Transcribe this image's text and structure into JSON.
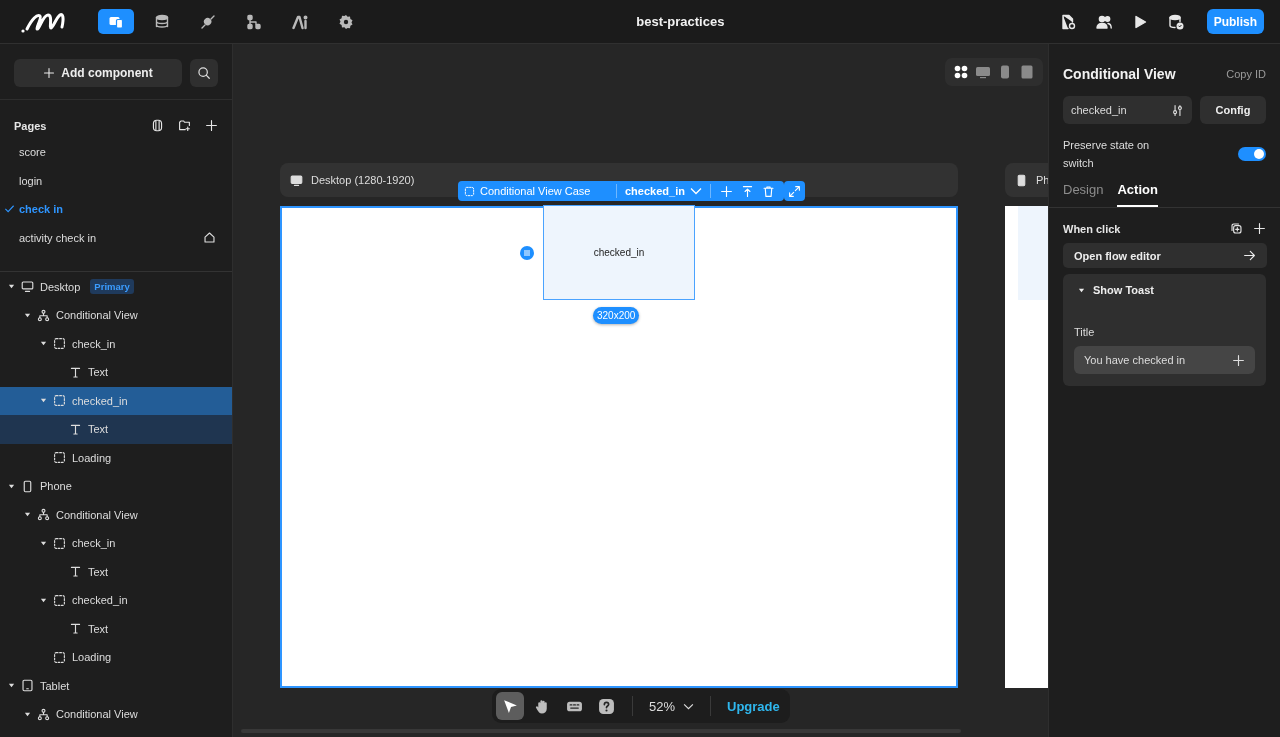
{
  "topbar": {
    "nav": [
      {
        "kind": "pages",
        "selected": true
      },
      {
        "kind": "database",
        "selected": false
      },
      {
        "kind": "plugin",
        "selected": false
      },
      {
        "kind": "flow",
        "selected": false
      },
      {
        "kind": "ai",
        "selected": false
      },
      {
        "kind": "settings",
        "selected": false
      }
    ],
    "title": "best-practices",
    "actions": [
      {
        "kind": "doc-settings"
      },
      {
        "kind": "users"
      },
      {
        "kind": "play"
      },
      {
        "kind": "db-check"
      }
    ],
    "publish": "Publish"
  },
  "sidebar": {
    "add_component": "Add component",
    "pages_title": "Pages",
    "pages": [
      {
        "label": "score",
        "selected": false,
        "home": false
      },
      {
        "label": "login",
        "selected": false,
        "home": false
      },
      {
        "label": "check in",
        "selected": true,
        "home": false
      },
      {
        "label": "activity check in",
        "selected": false,
        "home": true
      }
    ],
    "tree": [
      {
        "label": "Desktop",
        "kind": "desktop",
        "badge": "Primary",
        "expanded": true,
        "selected": false,
        "children": [
          {
            "label": "Conditional View",
            "kind": "conditional",
            "expanded": true,
            "selected": false,
            "children": [
              {
                "label": "check_in",
                "kind": "case",
                "expanded": true,
                "selected": false,
                "children": [
                  {
                    "label": "Text",
                    "kind": "text",
                    "selected": false
                  }
                ]
              },
              {
                "label": "checked_in",
                "kind": "case",
                "expanded": true,
                "selected": true,
                "children": [
                  {
                    "label": "Text",
                    "kind": "text",
                    "selected": false
                  }
                ]
              },
              {
                "label": "Loading",
                "kind": "case",
                "selected": false
              }
            ]
          }
        ]
      },
      {
        "label": "Phone",
        "kind": "phone",
        "expanded": true,
        "selected": false,
        "children": [
          {
            "label": "Conditional View",
            "kind": "conditional",
            "expanded": true,
            "selected": false,
            "children": [
              {
                "label": "check_in",
                "kind": "case",
                "expanded": true,
                "selected": false,
                "children": [
                  {
                    "label": "Text",
                    "kind": "text",
                    "selected": false
                  }
                ]
              },
              {
                "label": "checked_in",
                "kind": "case",
                "expanded": true,
                "selected": false,
                "children": [
                  {
                    "label": "Text",
                    "kind": "text",
                    "selected": false
                  }
                ]
              },
              {
                "label": "Loading",
                "kind": "case",
                "selected": false
              }
            ]
          }
        ]
      },
      {
        "label": "Tablet",
        "kind": "tablet",
        "expanded": true,
        "selected": false,
        "children": [
          {
            "label": "Conditional View",
            "kind": "conditional",
            "expanded": true,
            "selected": false
          }
        ]
      }
    ]
  },
  "canvas": {
    "devices": [
      {
        "kind": "all",
        "selected": true
      },
      {
        "kind": "desktop",
        "selected": false
      },
      {
        "kind": "phone",
        "selected": false
      },
      {
        "kind": "tablet",
        "selected": false
      }
    ],
    "desktop_frame": {
      "label": "Desktop (1280-1920)"
    },
    "phone_frame": {
      "label": "Ph"
    },
    "selection": {
      "type": "Conditional View Case",
      "case": "checked_in",
      "content": "checked_in",
      "size": "320x200"
    },
    "toolbar": {
      "tools": [
        {
          "kind": "pointer",
          "selected": true
        },
        {
          "kind": "hand",
          "selected": false
        },
        {
          "kind": "keyboard",
          "selected": false
        },
        {
          "kind": "help",
          "selected": false
        }
      ],
      "zoom": "52%",
      "upgrade": "Upgrade"
    }
  },
  "inspector": {
    "title": "Conditional View",
    "copy_id": "Copy ID",
    "case_value": "checked_in",
    "config": "Config",
    "preserve_label": "Preserve state on switch",
    "preserve_on": true,
    "tabs": [
      {
        "label": "Design",
        "selected": false
      },
      {
        "label": "Action",
        "selected": true
      }
    ],
    "event": "When click",
    "flow_button": "Open flow editor",
    "action": {
      "title": "Show Toast",
      "expanded": true,
      "field_label": "Title",
      "field_value": "You have checked in"
    }
  }
}
